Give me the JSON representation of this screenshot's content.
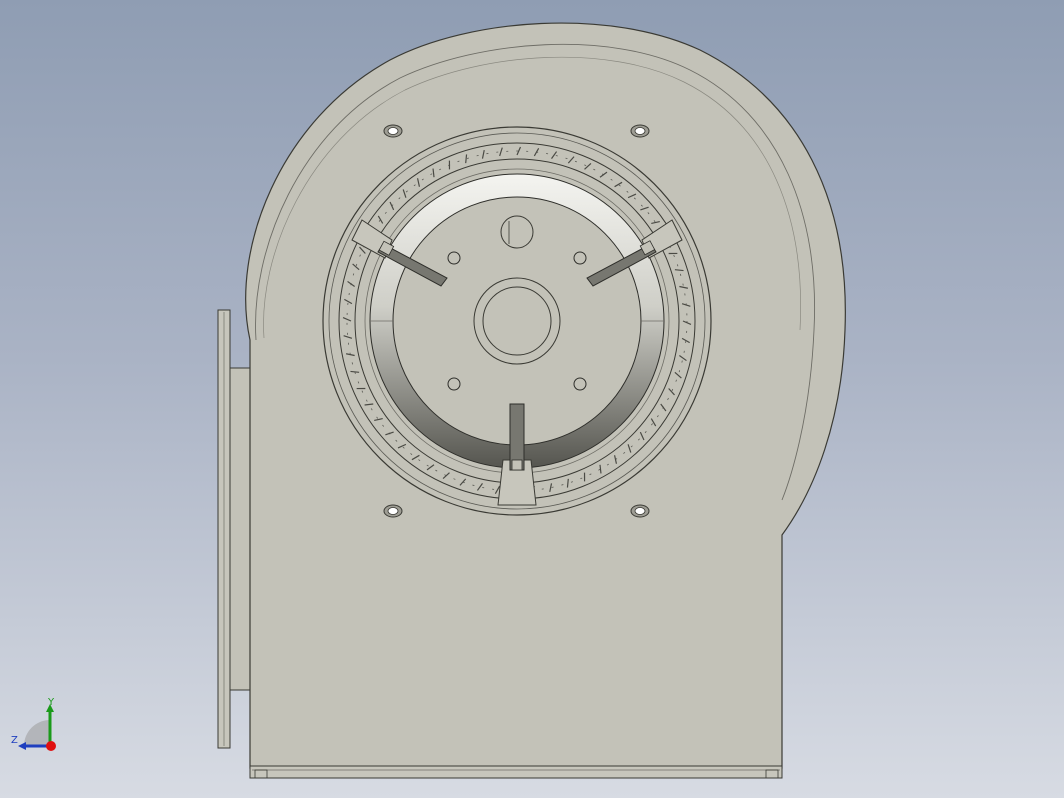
{
  "viewport": {
    "background_top": "#8f9db3",
    "background_bottom": "#d7dbe3"
  },
  "model": {
    "name": "centrifugal-blower",
    "housing_color": "#c3c2b8",
    "edge_color": "#3a3a34",
    "view": "front"
  },
  "triad": {
    "y_label": "Y",
    "z_label": "Z",
    "y_color": "#1a9a1a",
    "z_color": "#1f3fbf",
    "x_color": "#e01010"
  }
}
